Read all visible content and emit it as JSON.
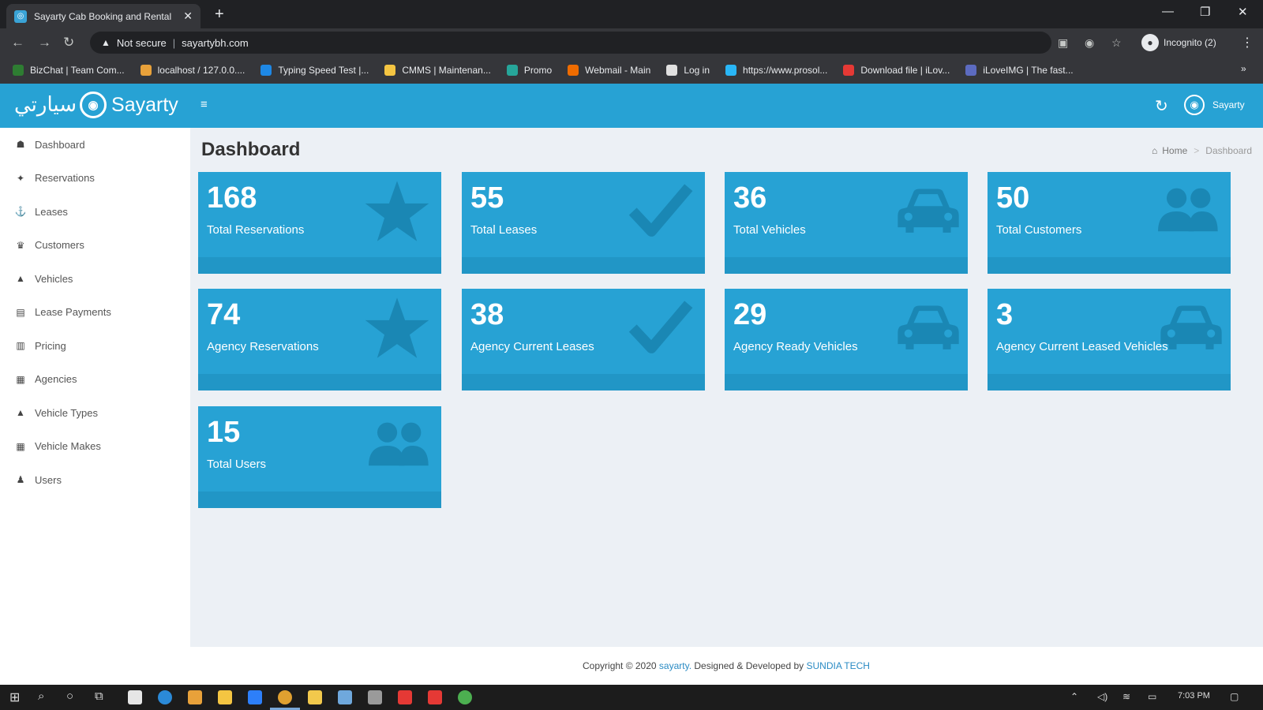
{
  "browser": {
    "tab_title": "Sayarty Cab Booking and Rental",
    "security_label": "Not secure",
    "url": "sayartybh.com",
    "profile_label": "Incognito (2)",
    "bookmarks": [
      {
        "label": "BizChat | Team Com...",
        "color": "#2e7d32"
      },
      {
        "label": "localhost / 127.0.0....",
        "color": "#e8a13a"
      },
      {
        "label": "Typing Speed Test |...",
        "color": "#1e88e5"
      },
      {
        "label": "CMMS | Maintenan...",
        "color": "#f4c542"
      },
      {
        "label": "Promo",
        "color": "#26a69a"
      },
      {
        "label": "Webmail - Main",
        "color": "#ef6c00"
      },
      {
        "label": "Log in",
        "color": "#e0e0e0"
      },
      {
        "label": "https://www.prosol...",
        "color": "#29b6f6"
      },
      {
        "label": "Download file | iLov...",
        "color": "#e53935"
      },
      {
        "label": "iLoveIMG | The fast...",
        "color": "#5c6bc0"
      }
    ]
  },
  "header": {
    "logo_arabic": "سيارتي",
    "logo_text": "Sayarty",
    "user_name": "Sayarty"
  },
  "sidebar": {
    "items": [
      {
        "label": "Dashboard",
        "icon": "dashboard-icon",
        "glyph": "☗"
      },
      {
        "label": "Reservations",
        "icon": "pin-icon",
        "glyph": "✦"
      },
      {
        "label": "Leases",
        "icon": "anchor-icon",
        "glyph": "⚓"
      },
      {
        "label": "Customers",
        "icon": "users-icon",
        "glyph": "♛"
      },
      {
        "label": "Vehicles",
        "icon": "car-icon",
        "glyph": "▲"
      },
      {
        "label": "Lease Payments",
        "icon": "payment-icon",
        "glyph": "▤"
      },
      {
        "label": "Pricing",
        "icon": "pricing-icon",
        "glyph": "▥"
      },
      {
        "label": "Agencies",
        "icon": "building-icon",
        "glyph": "▦"
      },
      {
        "label": "Vehicle Types",
        "icon": "car-type-icon",
        "glyph": "▲"
      },
      {
        "label": "Vehicle Makes",
        "icon": "make-icon",
        "glyph": "▦"
      },
      {
        "label": "Users",
        "icon": "user-icon",
        "glyph": "♟"
      }
    ]
  },
  "main": {
    "title": "Dashboard",
    "breadcrumb": {
      "home": "Home",
      "current": "Dashboard"
    },
    "cards": [
      {
        "value": "168",
        "label": "Total Reservations",
        "icon": "star-icon"
      },
      {
        "value": "55",
        "label": "Total Leases",
        "icon": "check-icon"
      },
      {
        "value": "36",
        "label": "Total Vehicles",
        "icon": "car-icon"
      },
      {
        "value": "50",
        "label": "Total Customers",
        "icon": "users-icon"
      },
      {
        "value": "74",
        "label": "Agency Reservations",
        "icon": "star-icon"
      },
      {
        "value": "38",
        "label": "Agency Current Leases",
        "icon": "check-icon"
      },
      {
        "value": "29",
        "label": "Agency Ready Vehicles",
        "icon": "car-icon"
      },
      {
        "value": "3",
        "label": "Agency Current Leased Vehicles",
        "icon": "car-icon"
      },
      {
        "value": "15",
        "label": "Total Users",
        "icon": "users-icon"
      }
    ]
  },
  "footer": {
    "prefix": "Copyright © 2020",
    "brand": "sayarty.",
    "middle": "Designed & Developed by",
    "developer": "SUNDIA TECH"
  },
  "taskbar": {
    "time": "7:03 PM"
  },
  "colors": {
    "header": "#27a2d4",
    "card": "#27a2d4",
    "card_footer": "#2196c6",
    "icon_shade": "#1a86b3"
  }
}
